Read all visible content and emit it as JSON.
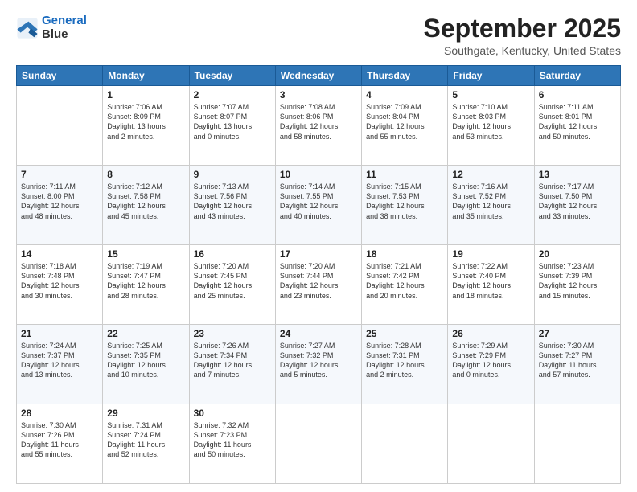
{
  "logo": {
    "line1": "General",
    "line2": "Blue"
  },
  "title": "September 2025",
  "location": "Southgate, Kentucky, United States",
  "days_of_week": [
    "Sunday",
    "Monday",
    "Tuesday",
    "Wednesday",
    "Thursday",
    "Friday",
    "Saturday"
  ],
  "weeks": [
    [
      {
        "day": "",
        "info": ""
      },
      {
        "day": "1",
        "info": "Sunrise: 7:06 AM\nSunset: 8:09 PM\nDaylight: 13 hours\nand 2 minutes."
      },
      {
        "day": "2",
        "info": "Sunrise: 7:07 AM\nSunset: 8:07 PM\nDaylight: 13 hours\nand 0 minutes."
      },
      {
        "day": "3",
        "info": "Sunrise: 7:08 AM\nSunset: 8:06 PM\nDaylight: 12 hours\nand 58 minutes."
      },
      {
        "day": "4",
        "info": "Sunrise: 7:09 AM\nSunset: 8:04 PM\nDaylight: 12 hours\nand 55 minutes."
      },
      {
        "day": "5",
        "info": "Sunrise: 7:10 AM\nSunset: 8:03 PM\nDaylight: 12 hours\nand 53 minutes."
      },
      {
        "day": "6",
        "info": "Sunrise: 7:11 AM\nSunset: 8:01 PM\nDaylight: 12 hours\nand 50 minutes."
      }
    ],
    [
      {
        "day": "7",
        "info": "Sunrise: 7:11 AM\nSunset: 8:00 PM\nDaylight: 12 hours\nand 48 minutes."
      },
      {
        "day": "8",
        "info": "Sunrise: 7:12 AM\nSunset: 7:58 PM\nDaylight: 12 hours\nand 45 minutes."
      },
      {
        "day": "9",
        "info": "Sunrise: 7:13 AM\nSunset: 7:56 PM\nDaylight: 12 hours\nand 43 minutes."
      },
      {
        "day": "10",
        "info": "Sunrise: 7:14 AM\nSunset: 7:55 PM\nDaylight: 12 hours\nand 40 minutes."
      },
      {
        "day": "11",
        "info": "Sunrise: 7:15 AM\nSunset: 7:53 PM\nDaylight: 12 hours\nand 38 minutes."
      },
      {
        "day": "12",
        "info": "Sunrise: 7:16 AM\nSunset: 7:52 PM\nDaylight: 12 hours\nand 35 minutes."
      },
      {
        "day": "13",
        "info": "Sunrise: 7:17 AM\nSunset: 7:50 PM\nDaylight: 12 hours\nand 33 minutes."
      }
    ],
    [
      {
        "day": "14",
        "info": "Sunrise: 7:18 AM\nSunset: 7:48 PM\nDaylight: 12 hours\nand 30 minutes."
      },
      {
        "day": "15",
        "info": "Sunrise: 7:19 AM\nSunset: 7:47 PM\nDaylight: 12 hours\nand 28 minutes."
      },
      {
        "day": "16",
        "info": "Sunrise: 7:20 AM\nSunset: 7:45 PM\nDaylight: 12 hours\nand 25 minutes."
      },
      {
        "day": "17",
        "info": "Sunrise: 7:20 AM\nSunset: 7:44 PM\nDaylight: 12 hours\nand 23 minutes."
      },
      {
        "day": "18",
        "info": "Sunrise: 7:21 AM\nSunset: 7:42 PM\nDaylight: 12 hours\nand 20 minutes."
      },
      {
        "day": "19",
        "info": "Sunrise: 7:22 AM\nSunset: 7:40 PM\nDaylight: 12 hours\nand 18 minutes."
      },
      {
        "day": "20",
        "info": "Sunrise: 7:23 AM\nSunset: 7:39 PM\nDaylight: 12 hours\nand 15 minutes."
      }
    ],
    [
      {
        "day": "21",
        "info": "Sunrise: 7:24 AM\nSunset: 7:37 PM\nDaylight: 12 hours\nand 13 minutes."
      },
      {
        "day": "22",
        "info": "Sunrise: 7:25 AM\nSunset: 7:35 PM\nDaylight: 12 hours\nand 10 minutes."
      },
      {
        "day": "23",
        "info": "Sunrise: 7:26 AM\nSunset: 7:34 PM\nDaylight: 12 hours\nand 7 minutes."
      },
      {
        "day": "24",
        "info": "Sunrise: 7:27 AM\nSunset: 7:32 PM\nDaylight: 12 hours\nand 5 minutes."
      },
      {
        "day": "25",
        "info": "Sunrise: 7:28 AM\nSunset: 7:31 PM\nDaylight: 12 hours\nand 2 minutes."
      },
      {
        "day": "26",
        "info": "Sunrise: 7:29 AM\nSunset: 7:29 PM\nDaylight: 12 hours\nand 0 minutes."
      },
      {
        "day": "27",
        "info": "Sunrise: 7:30 AM\nSunset: 7:27 PM\nDaylight: 11 hours\nand 57 minutes."
      }
    ],
    [
      {
        "day": "28",
        "info": "Sunrise: 7:30 AM\nSunset: 7:26 PM\nDaylight: 11 hours\nand 55 minutes."
      },
      {
        "day": "29",
        "info": "Sunrise: 7:31 AM\nSunset: 7:24 PM\nDaylight: 11 hours\nand 52 minutes."
      },
      {
        "day": "30",
        "info": "Sunrise: 7:32 AM\nSunset: 7:23 PM\nDaylight: 11 hours\nand 50 minutes."
      },
      {
        "day": "",
        "info": ""
      },
      {
        "day": "",
        "info": ""
      },
      {
        "day": "",
        "info": ""
      },
      {
        "day": "",
        "info": ""
      }
    ]
  ]
}
